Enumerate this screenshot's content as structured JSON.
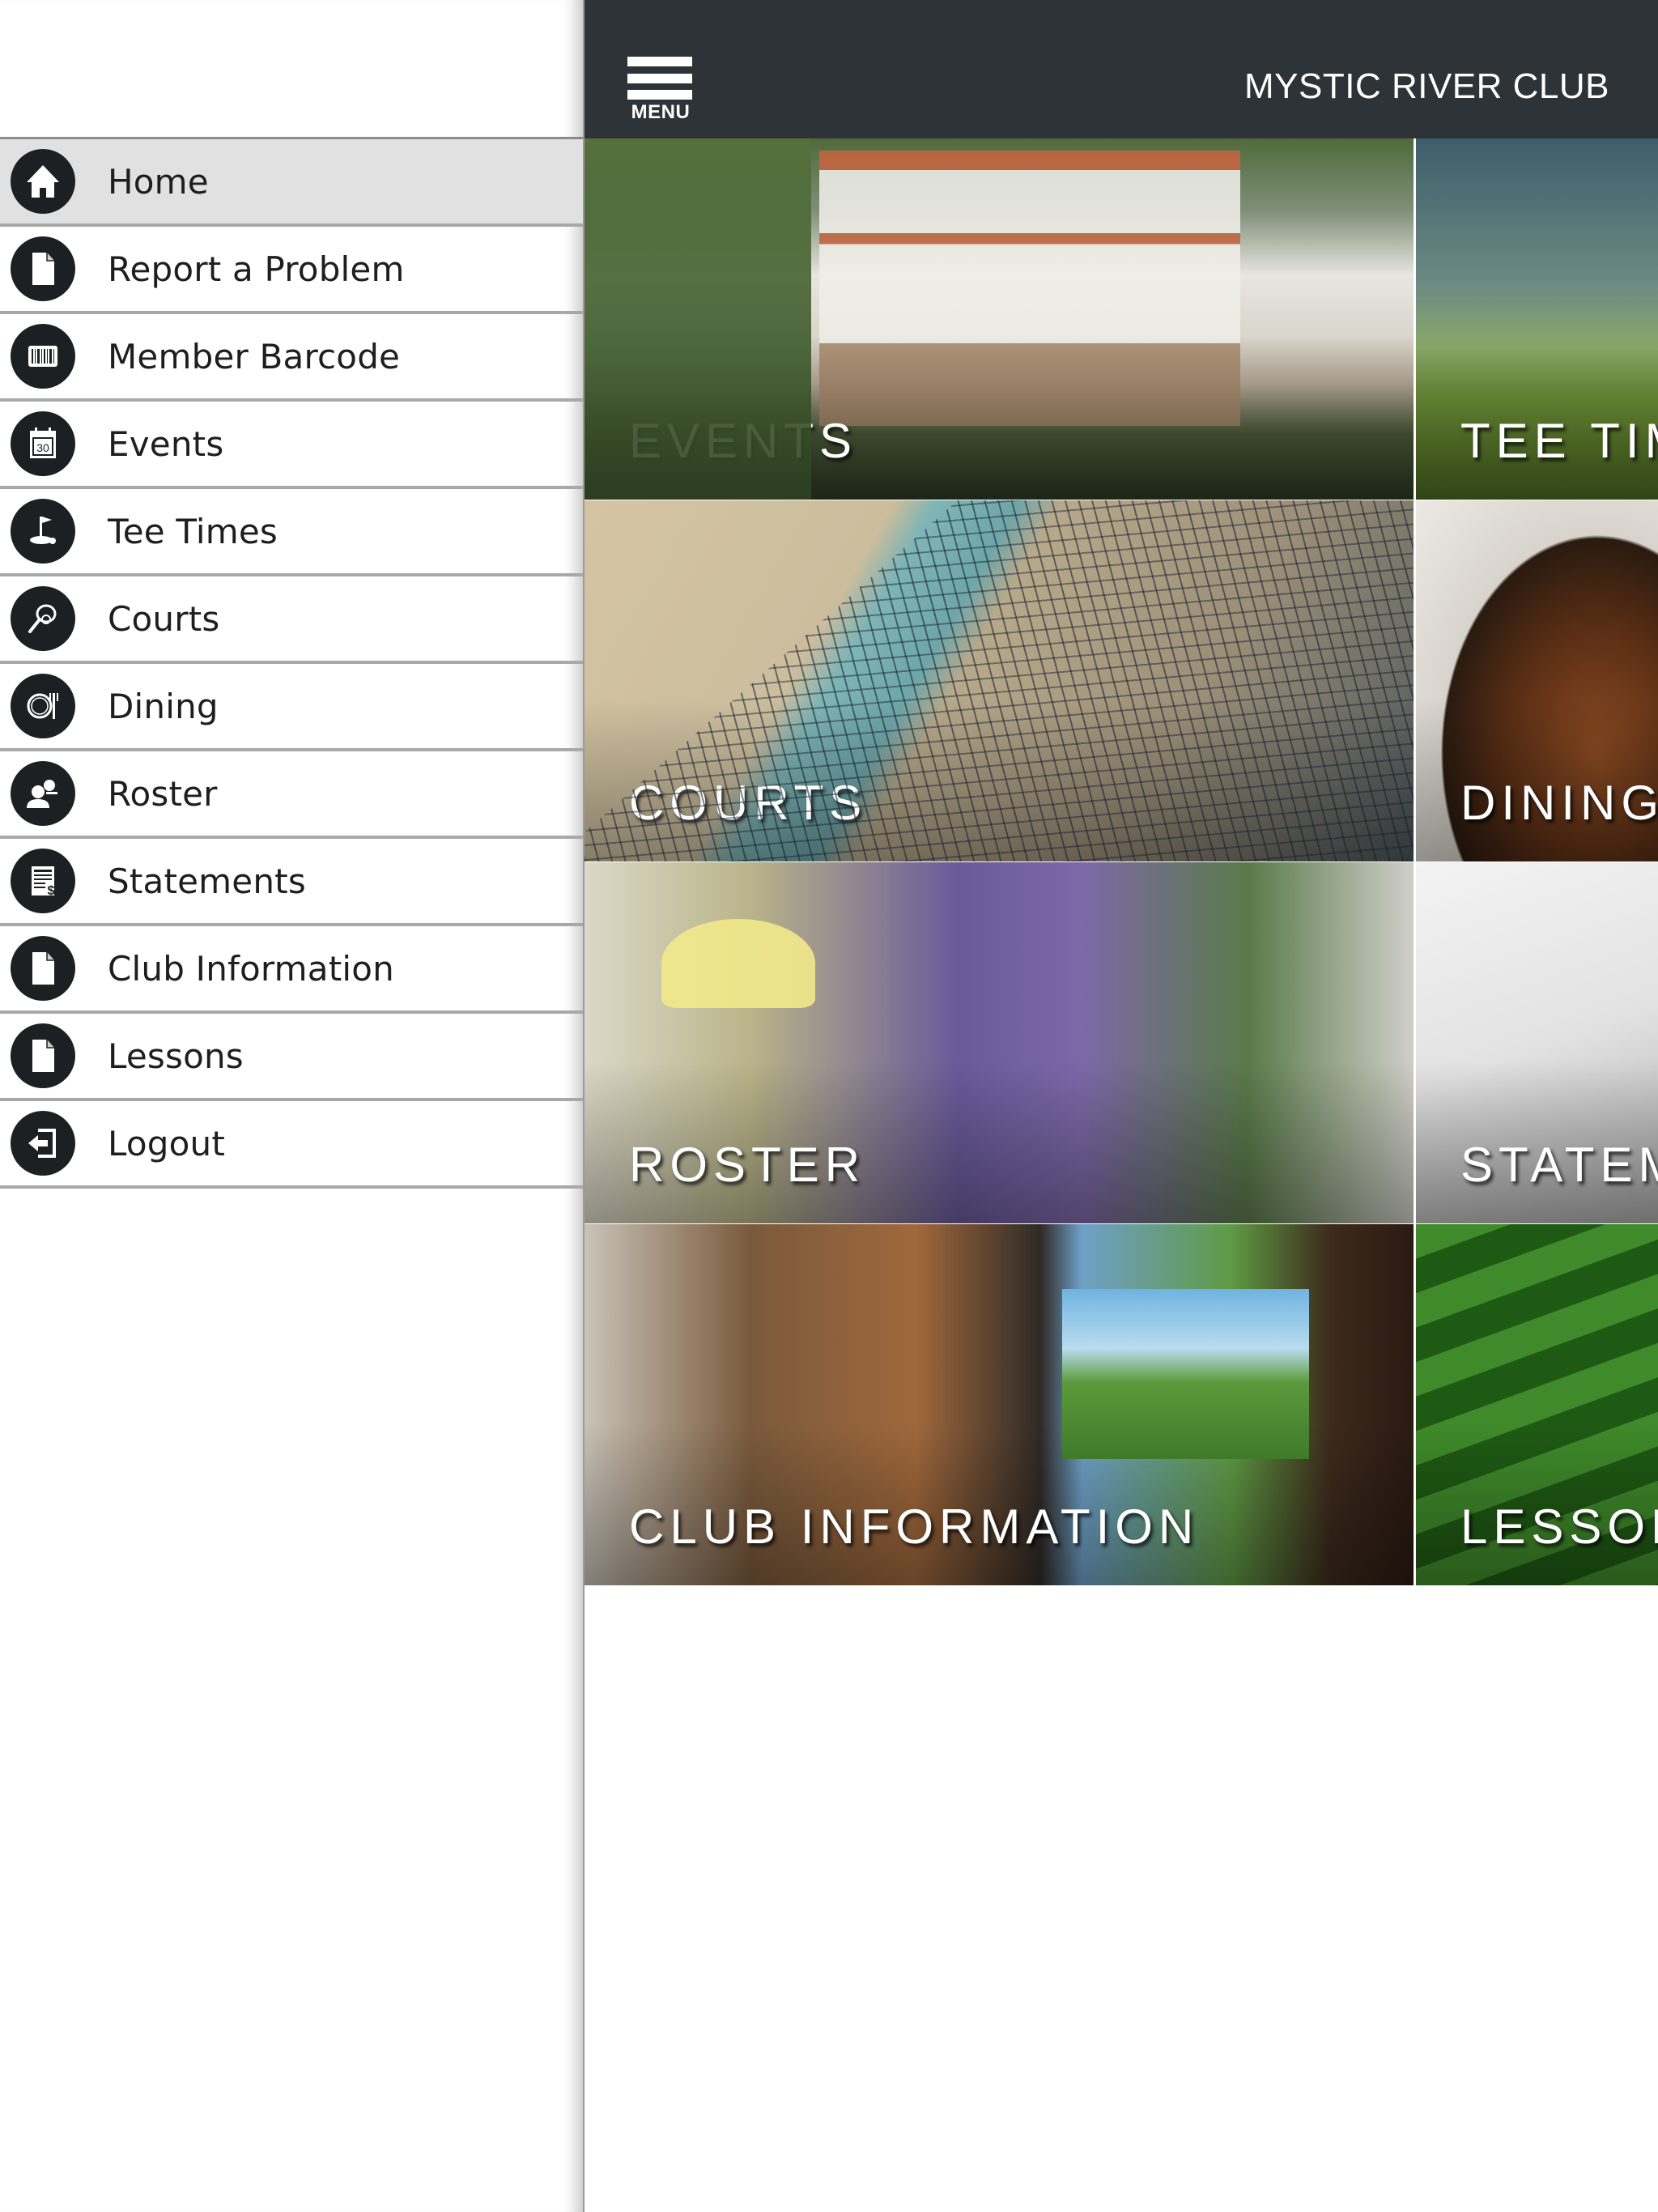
{
  "header": {
    "title": "MYSTIC RIVER CLUB",
    "menu_label": "MENU",
    "background_color": "#2e3338"
  },
  "side_menu": {
    "active_item": "Home",
    "items": [
      {
        "label": "Home",
        "icon": "home-icon"
      },
      {
        "label": "Report a Problem",
        "icon": "document-icon"
      },
      {
        "label": "Member Barcode",
        "icon": "barcode-icon"
      },
      {
        "label": "Events",
        "icon": "calendar-icon",
        "icon_text": "30"
      },
      {
        "label": "Tee Times",
        "icon": "golf-flag-icon"
      },
      {
        "label": "Courts",
        "icon": "tennis-racket-icon"
      },
      {
        "label": "Dining",
        "icon": "plate-fork-icon"
      },
      {
        "label": "Roster",
        "icon": "people-icon"
      },
      {
        "label": "Statements",
        "icon": "statement-dollar-icon"
      },
      {
        "label": "Club Information",
        "icon": "document-icon"
      },
      {
        "label": "Lessons",
        "icon": "document-icon"
      },
      {
        "label": "Logout",
        "icon": "logout-icon"
      }
    ]
  },
  "tiles": [
    {
      "label": "EVENTS"
    },
    {
      "label": "TEE TIMES"
    },
    {
      "label": "COURTS"
    },
    {
      "label": "DINING"
    },
    {
      "label": "ROSTER"
    },
    {
      "label": "STATEMENTS"
    },
    {
      "label": "CLUB INFORMATION"
    },
    {
      "label": "LESSONS"
    }
  ]
}
